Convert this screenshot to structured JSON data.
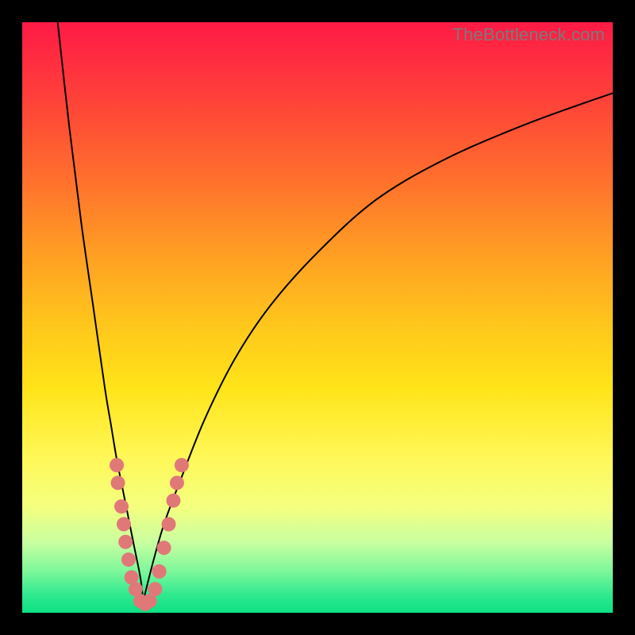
{
  "watermark": "TheBottleneck.com",
  "colors": {
    "frame": "#000000",
    "dot": "#e07878",
    "gradient_top": "#ff1a46",
    "gradient_bottom": "#0de083"
  },
  "chart_data": {
    "type": "line",
    "title": "",
    "xlabel": "",
    "ylabel": "",
    "xlim": [
      0,
      100
    ],
    "ylim": [
      0,
      100
    ],
    "series": [
      {
        "name": "left-curve",
        "x": [
          6,
          8,
          10,
          12,
          14,
          15,
          16,
          17,
          18,
          19,
          20,
          20.5
        ],
        "y": [
          100,
          82,
          66,
          52,
          38,
          32,
          26,
          21,
          16,
          11,
          6,
          2
        ]
      },
      {
        "name": "right-curve",
        "x": [
          20.5,
          22,
          24,
          27,
          31,
          36,
          42,
          50,
          60,
          72,
          86,
          100
        ],
        "y": [
          2,
          8,
          15,
          23,
          33,
          43,
          52,
          61,
          70,
          77,
          83,
          88
        ]
      }
    ],
    "points": [
      {
        "x": 16.0,
        "y": 25
      },
      {
        "x": 16.2,
        "y": 22
      },
      {
        "x": 16.8,
        "y": 18
      },
      {
        "x": 17.2,
        "y": 15
      },
      {
        "x": 17.5,
        "y": 12
      },
      {
        "x": 18.0,
        "y": 9
      },
      {
        "x": 18.5,
        "y": 6
      },
      {
        "x": 19.2,
        "y": 4
      },
      {
        "x": 20.0,
        "y": 2
      },
      {
        "x": 20.8,
        "y": 1.5
      },
      {
        "x": 21.6,
        "y": 2
      },
      {
        "x": 22.5,
        "y": 4
      },
      {
        "x": 23.2,
        "y": 7
      },
      {
        "x": 24.0,
        "y": 11
      },
      {
        "x": 24.8,
        "y": 15
      },
      {
        "x": 25.6,
        "y": 19
      },
      {
        "x": 26.2,
        "y": 22
      },
      {
        "x": 27.0,
        "y": 25
      }
    ],
    "point_radius": 9
  }
}
